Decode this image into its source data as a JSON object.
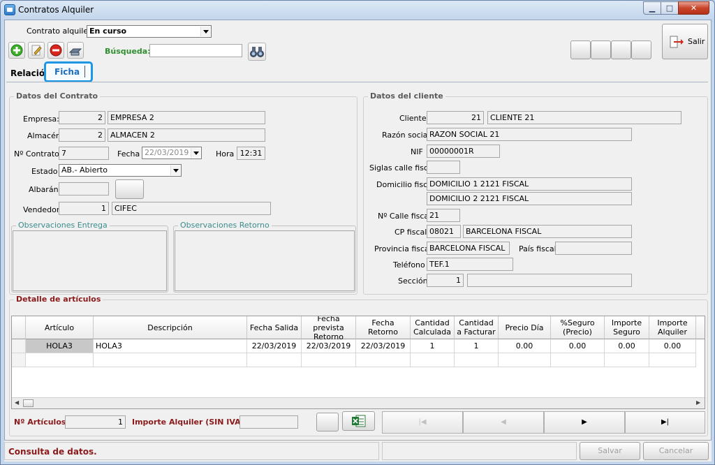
{
  "window": {
    "title": "Contratos Alquiler",
    "minimize": "▁",
    "maximize": "□",
    "close": "✕"
  },
  "top": {
    "contract_label": "Contrato alquiler",
    "contract_value": "En curso",
    "search_label": "Búsqueda:",
    "search_value": "",
    "exit_label": "Salir"
  },
  "tabs": [
    {
      "label": "Relación"
    },
    {
      "label": "Ficha"
    }
  ],
  "contrato": {
    "title": "Datos del Contrato",
    "empresa_label": "Empresa:",
    "empresa_code": "2",
    "empresa_name": "EMPRESA 2",
    "almacen_label": "Almacén",
    "almacen_code": "2",
    "almacen_name": "ALMACEN 2",
    "ncontrato_label": "Nº Contrato",
    "ncontrato_value": "7",
    "fecha_label": "Fecha",
    "fecha_value": "22/03/2019",
    "hora_label": "Hora",
    "hora_value": "12:31",
    "estado_label": "Estado",
    "estado_value": "AB.- Abierto",
    "albaran_label": "Albarán",
    "albaran_value": "",
    "vendedor_label": "Vendedor",
    "vendedor_code": "1",
    "vendedor_name": "CIFEC",
    "obs_entrega_title": "Observaciones Entrega",
    "obs_retorno_title": "Observaciones Retorno"
  },
  "cliente": {
    "title": "Datos del cliente",
    "cliente_label": "Cliente",
    "cliente_code": "21",
    "cliente_name": "CLIENTE 21",
    "razon_label": "Razón social",
    "razon_value": "RAZON SOCIAL 21",
    "nif_label": "NIF",
    "nif_value": "00000001R",
    "siglas_label": "Siglas calle fiscal",
    "siglas_value": "",
    "domicilio_label": "Domicilio fiscal",
    "domicilio1": "DOMICILIO 1 2121 FISCAL",
    "domicilio2": "DOMICILIO 2 2121 FISCAL",
    "ncalle_label": "Nº Calle fiscal",
    "ncalle_value": "21",
    "cp_label": "CP fiscal",
    "cp_value": "08021",
    "ciudad_value": "BARCELONA FISCAL",
    "provincia_label": "Provincia fiscal",
    "provincia_value": "BARCELONA FISCAL",
    "pais_label": "País fiscal",
    "pais_value": "",
    "telefono_label": "Teléfono",
    "telefono_value": "TEF.1",
    "seccion_label": "Sección",
    "seccion_code": "1",
    "seccion_name": ""
  },
  "detalle": {
    "title": "Detalle de artículos",
    "columns": [
      "Artículo",
      "Descripción",
      "Fecha Salida",
      "Fecha prevista Retorno",
      "Fecha Retorno",
      "Cantidad Calculada",
      "Cantidad a Facturar",
      "Precio Día",
      "%Seguro (Precio)",
      "Importe Seguro",
      "Importe Alquiler"
    ],
    "rows": [
      [
        "HOLA3",
        "HOLA3",
        "22/03/2019",
        "22/03/2019",
        "22/03/2019",
        "1",
        "1",
        "0.00",
        "0.00",
        "0.00",
        "0.00"
      ]
    ]
  },
  "footer": {
    "narticulos_label": "Nº Artículos:",
    "narticulos_value": "1",
    "importe_label": "Importe Alquiler (SIN IVA):",
    "importe_value": "",
    "nav_first": "|◀",
    "nav_prev": "◀",
    "nav_next": "▶",
    "nav_last": "▶|"
  },
  "status": {
    "message": "Consulta de datos.",
    "save_label": "Salvar",
    "cancel_label": "Cancelar"
  }
}
